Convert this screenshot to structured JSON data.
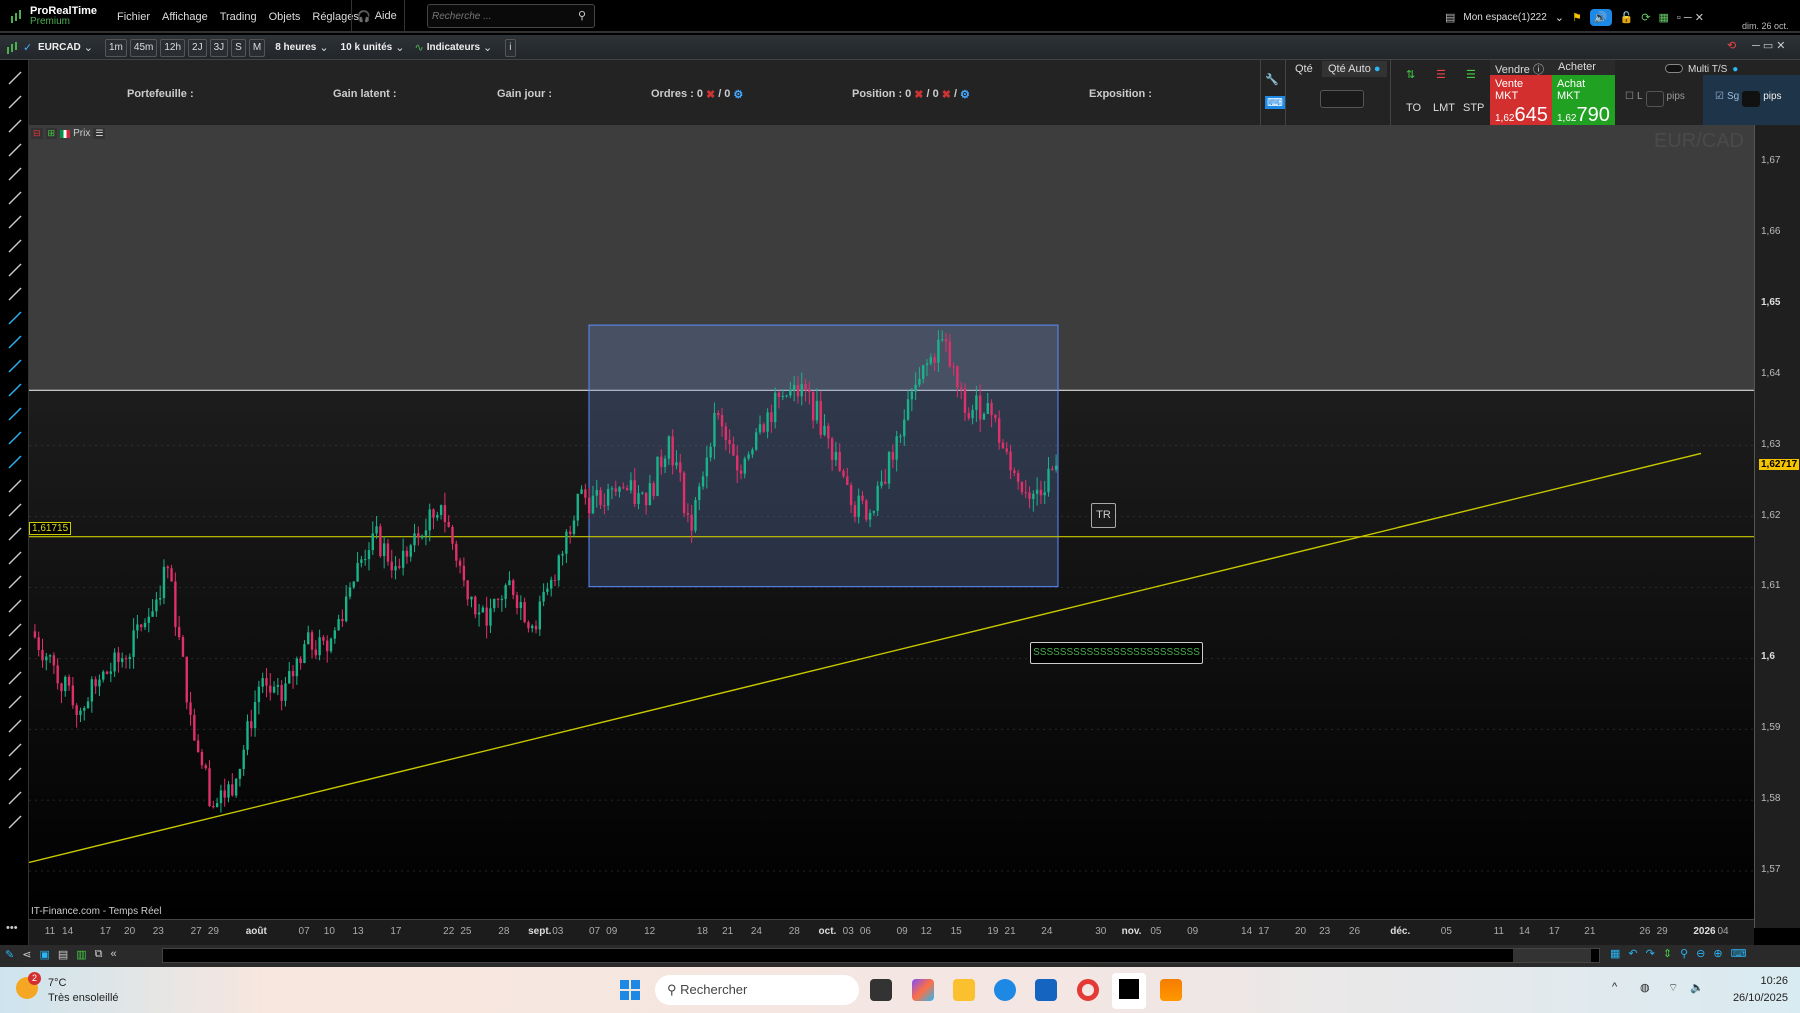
{
  "app": {
    "name": "ProRealTime",
    "edition": "Premium"
  },
  "menu": [
    "Fichier",
    "Affichage",
    "Trading",
    "Objets",
    "Réglages"
  ],
  "help": "Aide",
  "search": {
    "placeholder": "Recherche ..."
  },
  "workspace": "Mon espace(1)222",
  "date_short": "dim. 26 oct.",
  "toolbar": {
    "instrument": "EURCAD",
    "timeframes": [
      "1m",
      "45m",
      "12h",
      "2J",
      "3J",
      "S",
      "M"
    ],
    "period": "8 heures",
    "units": "10 k unités",
    "indicators": "Indicateurs"
  },
  "info": {
    "portfolio": "Portefeuille :",
    "latent": "Gain latent :",
    "day": "Gain jour :",
    "orders": "Ordres : 0",
    "orders2": "/ 0",
    "position": "Position : 0",
    "position2": "/ 0",
    "position3": "/",
    "exposure": "Exposition :"
  },
  "order_panel": {
    "qty": "Qté",
    "qty_auto": "Qté Auto",
    "to": "TO",
    "lmt": "LMT",
    "stp": "STP",
    "sell": "Vendre",
    "buy": "Acheter",
    "sell_mkt": "Vente MKT",
    "buy_mkt": "Achat MKT",
    "sell_prefix": "1,62",
    "sell_price": "645",
    "buy_prefix": "1,62",
    "buy_price": "790",
    "multi": "Multi T/S",
    "l": "L",
    "pips": "pips",
    "sg": "Sg",
    "pips2": "pips"
  },
  "chart_header": {
    "price_label": "Prix",
    "watermark": "EUR/CAD"
  },
  "chart_data": {
    "type": "candlestick",
    "instrument": "EUR/CAD",
    "closes": [
      1.6038,
      1.599,
      1.592,
      1.597,
      1.6,
      1.605,
      1.6127,
      1.592,
      1.579,
      1.583,
      1.596,
      1.594,
      1.602,
      1.601,
      1.61,
      1.6176,
      1.613,
      1.617,
      1.6216,
      1.611,
      1.6046,
      1.611,
      1.6046,
      1.611,
      1.6232,
      1.6216,
      1.624,
      1.6216,
      1.6313,
      1.618,
      1.6346,
      1.6265,
      1.633,
      1.637,
      1.6378,
      1.631,
      1.6216,
      1.6208,
      1.6313,
      1.6394,
      1.645,
      1.6346,
      1.636,
      1.6265,
      1.6232,
      1.62717
    ],
    "y_ticks": [
      "1,67",
      "1,66",
      "1,65",
      "1,64",
      "1,63",
      "1,62",
      "1,61",
      "1,6",
      "1,59",
      "1,58",
      "1,57"
    ],
    "ylim": [
      1.565,
      1.673
    ],
    "last_price": "1,62717",
    "hline_label": "1,61715",
    "hline_value": 1.61715,
    "white_line_value": 1.6378,
    "rectangle": {
      "top": 1.647,
      "bottom": 1.6101
    },
    "trendline": {
      "start": 1.5712,
      "end": 1.6289
    },
    "x_ticks": [
      "11",
      "14",
      "17",
      "20",
      "23",
      "27",
      "29",
      "août",
      "07",
      "10",
      "13",
      "17",
      "22",
      "25",
      "28",
      "sept.",
      "03",
      "07",
      "09",
      "12",
      "18",
      "21",
      "24",
      "28",
      "oct.",
      "03",
      "06",
      "09",
      "12",
      "15",
      "19",
      "21",
      "24",
      "30",
      "nov.",
      "05",
      "09",
      "14",
      "17",
      "20",
      "23",
      "26",
      "déc.",
      "05",
      "11",
      "14",
      "17",
      "21",
      "26",
      "29",
      "2026",
      "04"
    ],
    "annotations": [
      "TR",
      "SSSSSSSSSSSSSSSSSSSSSSSSS"
    ]
  },
  "source": "IT-Finance.com - Temps Réel",
  "left_tools": [
    "line-icon",
    "ray-icon",
    "line-icon",
    "horizontal-line-icon",
    "half-line-icon",
    "half-line-icon",
    "vertical-line-icon",
    "segment-icon",
    "vertical-segment-icon",
    "ruler-icon",
    "fibonacci-fan-icon",
    "angle-icon",
    "percent-icon",
    "channel-icon",
    "pattern-icon",
    "elliott-wave-icon",
    "abc-wave-icon",
    "pencil-icon",
    "zigzag-icon",
    "horizontal-levels-icon",
    "vertical-levels-icon",
    "rhombus-icon",
    "ellipse-icon",
    "circle-icon",
    "cross-circle-icon",
    "triangle-icon",
    "arc-icon",
    "arrow-up-icon",
    "arrow-down-icon",
    "check-icon",
    "cross-icon",
    "more-icon"
  ],
  "taskbar": {
    "temp": "7°C",
    "weather": "Très ensoleillé",
    "badge": "2",
    "search": "Rechercher",
    "time": "10:26",
    "date": "26/10/2025"
  }
}
